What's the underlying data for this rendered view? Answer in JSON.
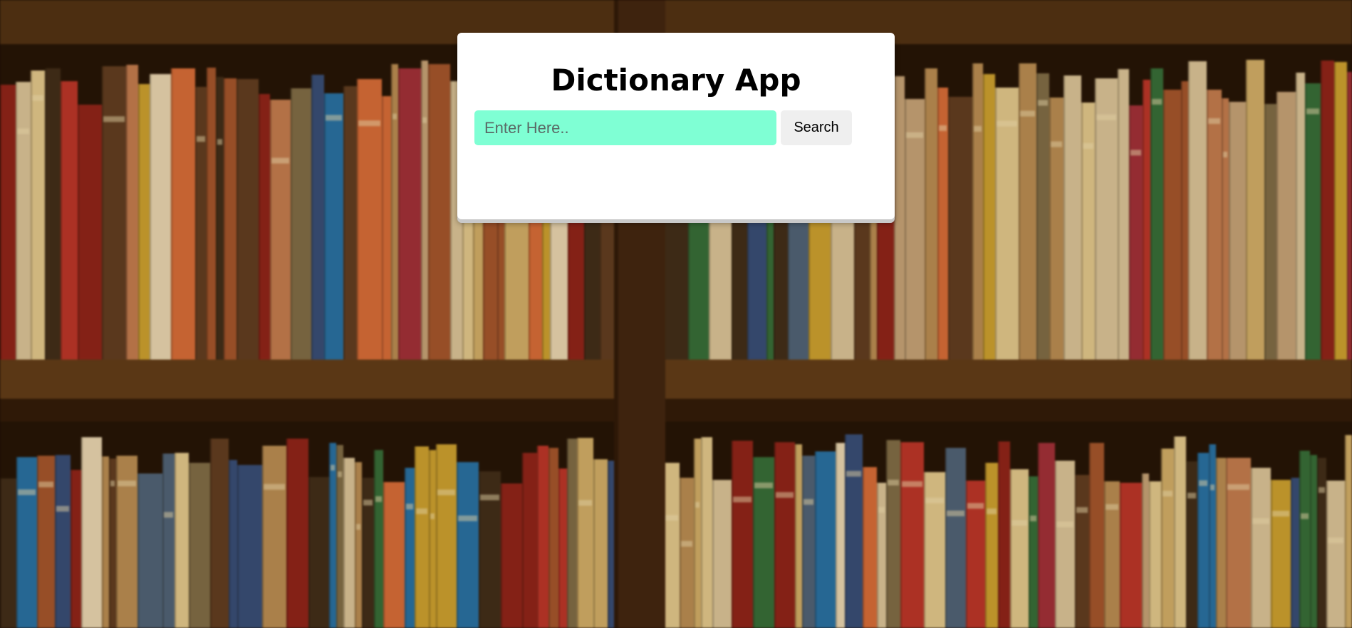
{
  "app": {
    "title": "Dictionary App"
  },
  "search": {
    "placeholder": "Enter Here..",
    "value": "",
    "button_label": "Search"
  },
  "colors": {
    "input_background": "#7fffd4",
    "button_background": "#efefef",
    "card_background": "#ffffff"
  },
  "background": {
    "description_icon": "bookshelf-image"
  }
}
